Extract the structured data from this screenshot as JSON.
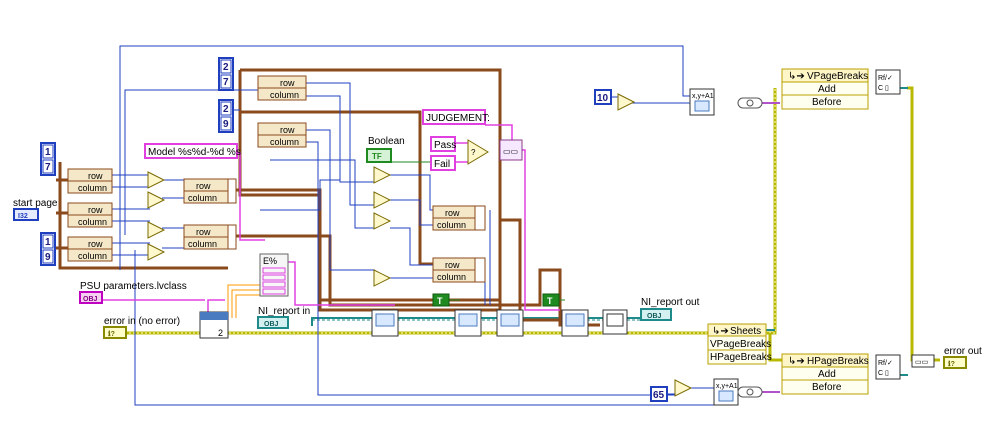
{
  "labels": {
    "start_page": "start page",
    "psu_class": "PSU parameters.lvclass",
    "error_in": "error in (no error)",
    "ni_report_in": "NI_report in",
    "ni_report_out": "NI_report out",
    "error_out": "error out",
    "boolean": "Boolean",
    "judgement": "JUDGEMENT:",
    "pass": "Pass",
    "fail": "Fail",
    "model_format": "Model %s%d-%d %s"
  },
  "constants": {
    "c2": "2",
    "c7": "7",
    "c9": "9",
    "c1": "1",
    "c10": "10",
    "c65": "65",
    "index2": "2"
  },
  "cluster": {
    "row": "row",
    "column": "column"
  },
  "property_nodes": {
    "vpagebreaks": "VPageBreaks",
    "hpagebreaks": "HPageBreaks",
    "add": "Add",
    "before": "Before",
    "sheets": "Sheets",
    "vpagebreaks_item": "VPageBreaks",
    "hpagebreaks_item": "HPageBreaks"
  },
  "terminals": {
    "obj": "OBJ",
    "i32": "I32",
    "tf": "TF",
    "t": "T"
  },
  "colors": {
    "cluster_wire": "#8b4a1c",
    "int_wire": "#1f3fbf",
    "string_wire": "#e040e0",
    "bool_wire": "#1f8a1f",
    "refnum_wire": "#1f8a8a",
    "error_wire": "#c8c800"
  }
}
